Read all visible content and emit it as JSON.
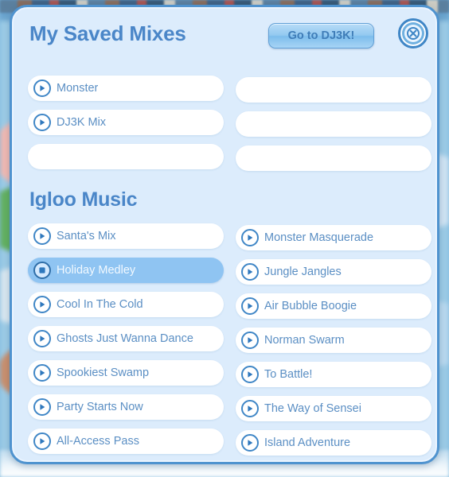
{
  "header": {
    "title": "My Saved Mixes",
    "dj_button_label": "Go to DJ3K!",
    "close_icon": "close-circle-x-icon"
  },
  "saved_mixes": {
    "left": [
      {
        "label": "Monster",
        "icon": "play-icon",
        "empty": false
      },
      {
        "label": "DJ3K Mix",
        "icon": "play-icon",
        "empty": false
      },
      {
        "label": "",
        "icon": "",
        "empty": true
      }
    ],
    "right": [
      {
        "label": "",
        "icon": "",
        "empty": true
      },
      {
        "label": "",
        "icon": "",
        "empty": true
      },
      {
        "label": "",
        "icon": "",
        "empty": true
      }
    ]
  },
  "igloo_music": {
    "title": "Igloo Music",
    "left": [
      {
        "label": "Santa's Mix",
        "icon": "play-icon",
        "active": false
      },
      {
        "label": "Holiday Medley",
        "icon": "stop-icon",
        "active": true
      },
      {
        "label": "Cool In The Cold",
        "icon": "play-icon",
        "active": false
      },
      {
        "label": "Ghosts Just Wanna Dance",
        "icon": "play-icon",
        "active": false
      },
      {
        "label": "Spookiest Swamp",
        "icon": "play-icon",
        "active": false
      },
      {
        "label": "Party Starts Now",
        "icon": "play-icon",
        "active": false
      },
      {
        "label": "All-Access Pass",
        "icon": "play-icon",
        "active": false
      }
    ],
    "right": [
      {
        "label": "Monster Masquerade",
        "icon": "play-icon",
        "active": false
      },
      {
        "label": "Jungle Jangles",
        "icon": "play-icon",
        "active": false
      },
      {
        "label": "Air Bubble Boogie",
        "icon": "play-icon",
        "active": false
      },
      {
        "label": "Norman Swarm",
        "icon": "play-icon",
        "active": false
      },
      {
        "label": "To Battle!",
        "icon": "play-icon",
        "active": false
      },
      {
        "label": "The Way of Sensei",
        "icon": "play-icon",
        "active": false
      },
      {
        "label": "Island Adventure",
        "icon": "play-icon",
        "active": false
      }
    ]
  },
  "colors": {
    "panel_background": "#dcecfc",
    "panel_border": "#4f93cf",
    "heading_text": "#4a86c8",
    "row_text": "#5b8fc4",
    "active_row_background": "#8fc4f2",
    "active_row_text": "#f2f9ff",
    "icon_stroke": "#3f86c6",
    "button_text": "#3f7db8"
  }
}
